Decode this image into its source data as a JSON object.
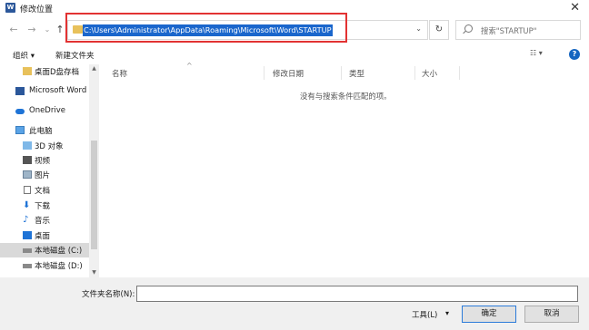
{
  "window": {
    "title": "修改位置",
    "app_icon": "W",
    "close": "✕"
  },
  "nav": {
    "back": "←",
    "forward": "→",
    "recent": "⌄",
    "up": "↑",
    "address": "C:\\Users\\Administrator\\AppData\\Roaming\\Microsoft\\Word\\STARTUP",
    "address_dropdown": "⌄",
    "refresh": "↻",
    "search_placeholder": "搜索\"STARTUP\""
  },
  "toolbar": {
    "organize": "组织 ▾",
    "new_folder": "新建文件夹",
    "view": "☷ ▾",
    "help": "?"
  },
  "sidebar": {
    "items": [
      {
        "label": "桌面D盘存档",
        "icon": "folder-icon"
      },
      {
        "label": "Microsoft Word",
        "icon": "word-icon"
      },
      {
        "label": "OneDrive",
        "icon": "cloud-icon"
      },
      {
        "label": "此电脑",
        "icon": "computer-icon"
      },
      {
        "label": "3D 对象",
        "icon": "cube-icon"
      },
      {
        "label": "视频",
        "icon": "video-icon"
      },
      {
        "label": "图片",
        "icon": "picture-icon"
      },
      {
        "label": "文档",
        "icon": "document-icon"
      },
      {
        "label": "下载",
        "icon": "download-icon"
      },
      {
        "label": "音乐",
        "icon": "music-icon"
      },
      {
        "label": "桌面",
        "icon": "desktop-icon"
      },
      {
        "label": "本地磁盘 (C:)",
        "icon": "drive-icon"
      },
      {
        "label": "本地磁盘 (D:)",
        "icon": "drive-icon"
      }
    ]
  },
  "columns": [
    "名称",
    "修改日期",
    "类型",
    "大小"
  ],
  "empty_message": "没有与搜索条件匹配的项。",
  "footer": {
    "folder_name_label": "文件夹名称(N):",
    "folder_name_value": "",
    "tools": "工具(L)",
    "tools_dropdown": "▾",
    "ok": "确定",
    "cancel": "取消"
  },
  "colors": {
    "accent": "#1a66cc",
    "highlight_border": "#e23232",
    "folder": "#e8c15b"
  }
}
